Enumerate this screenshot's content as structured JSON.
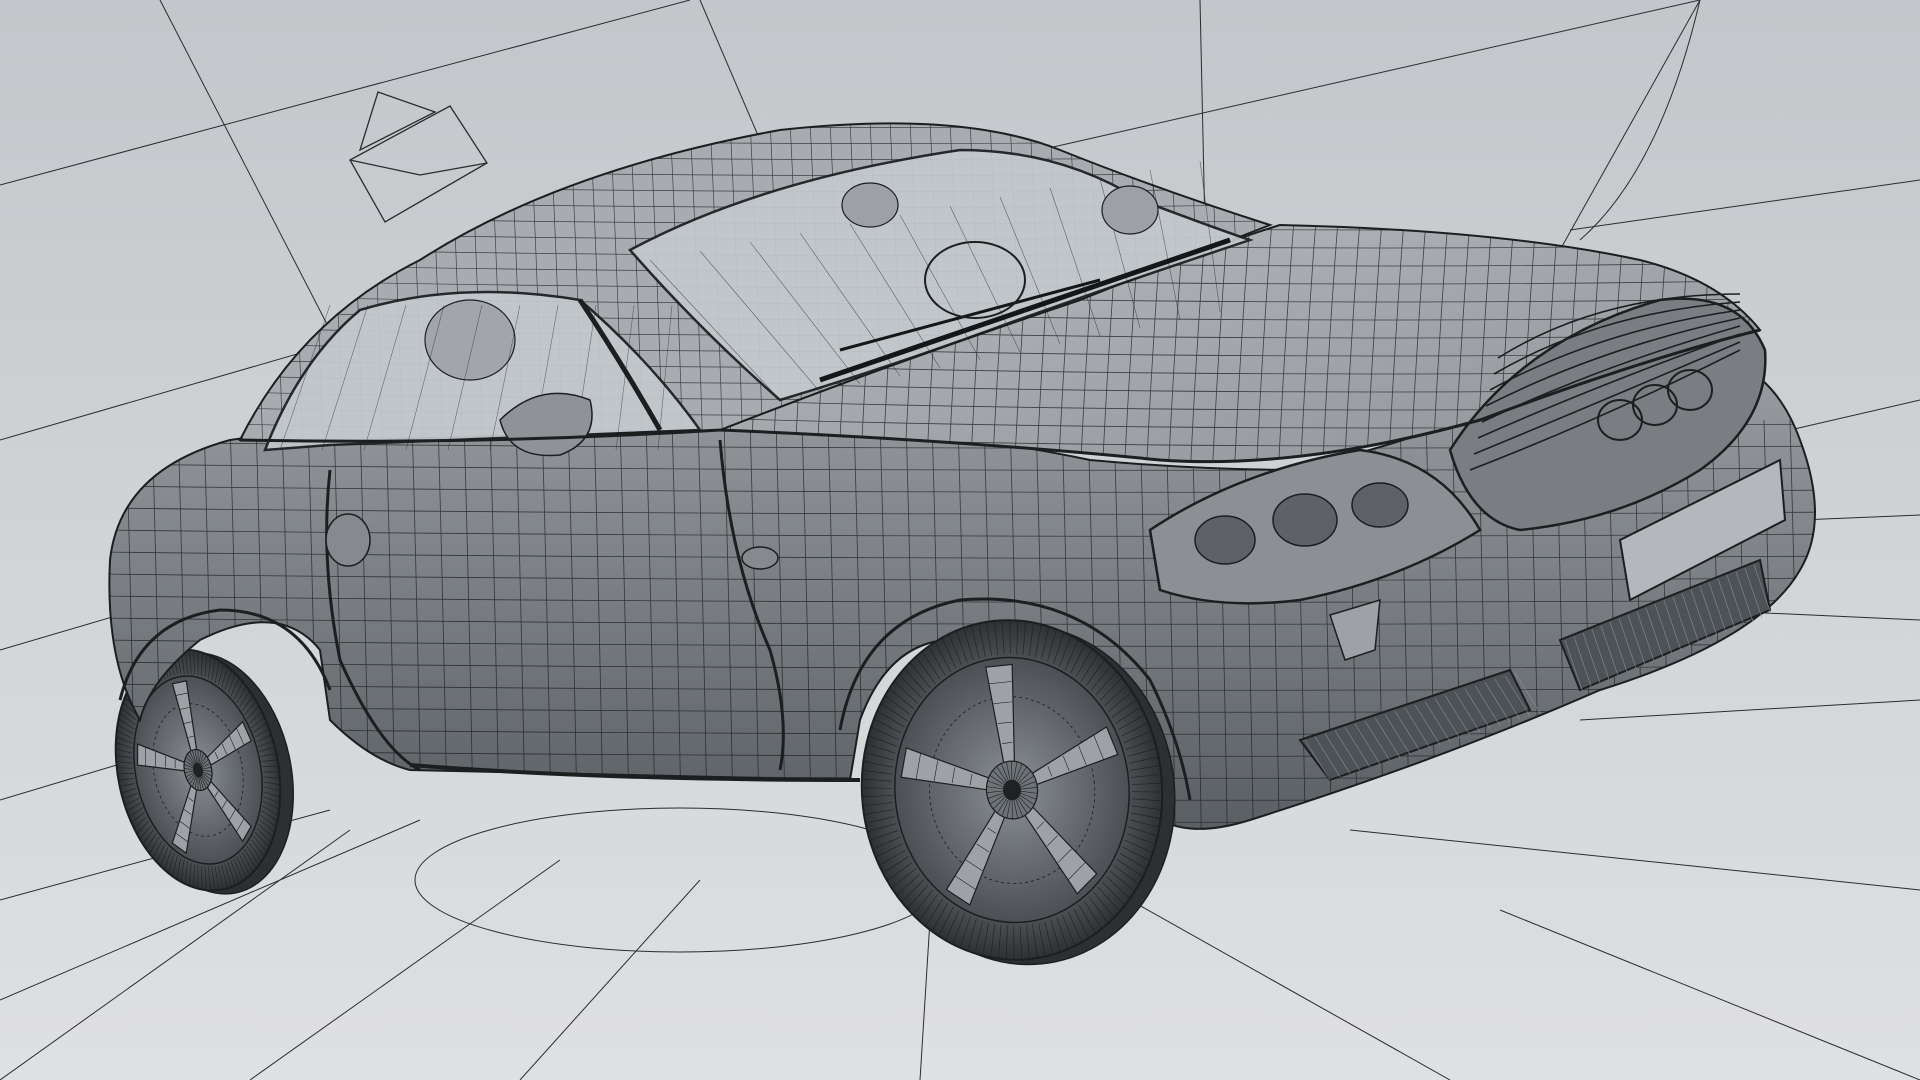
{
  "scene": {
    "subject": "wireframe-car-render",
    "background_top": "#c3c6ca",
    "background_bottom": "#dfe0e2",
    "body_shade_light": "#b9bcc0",
    "body_shade_dark": "#5f6468",
    "wire_color": "#1c1e20",
    "glass_color": "#c4c9cd"
  }
}
